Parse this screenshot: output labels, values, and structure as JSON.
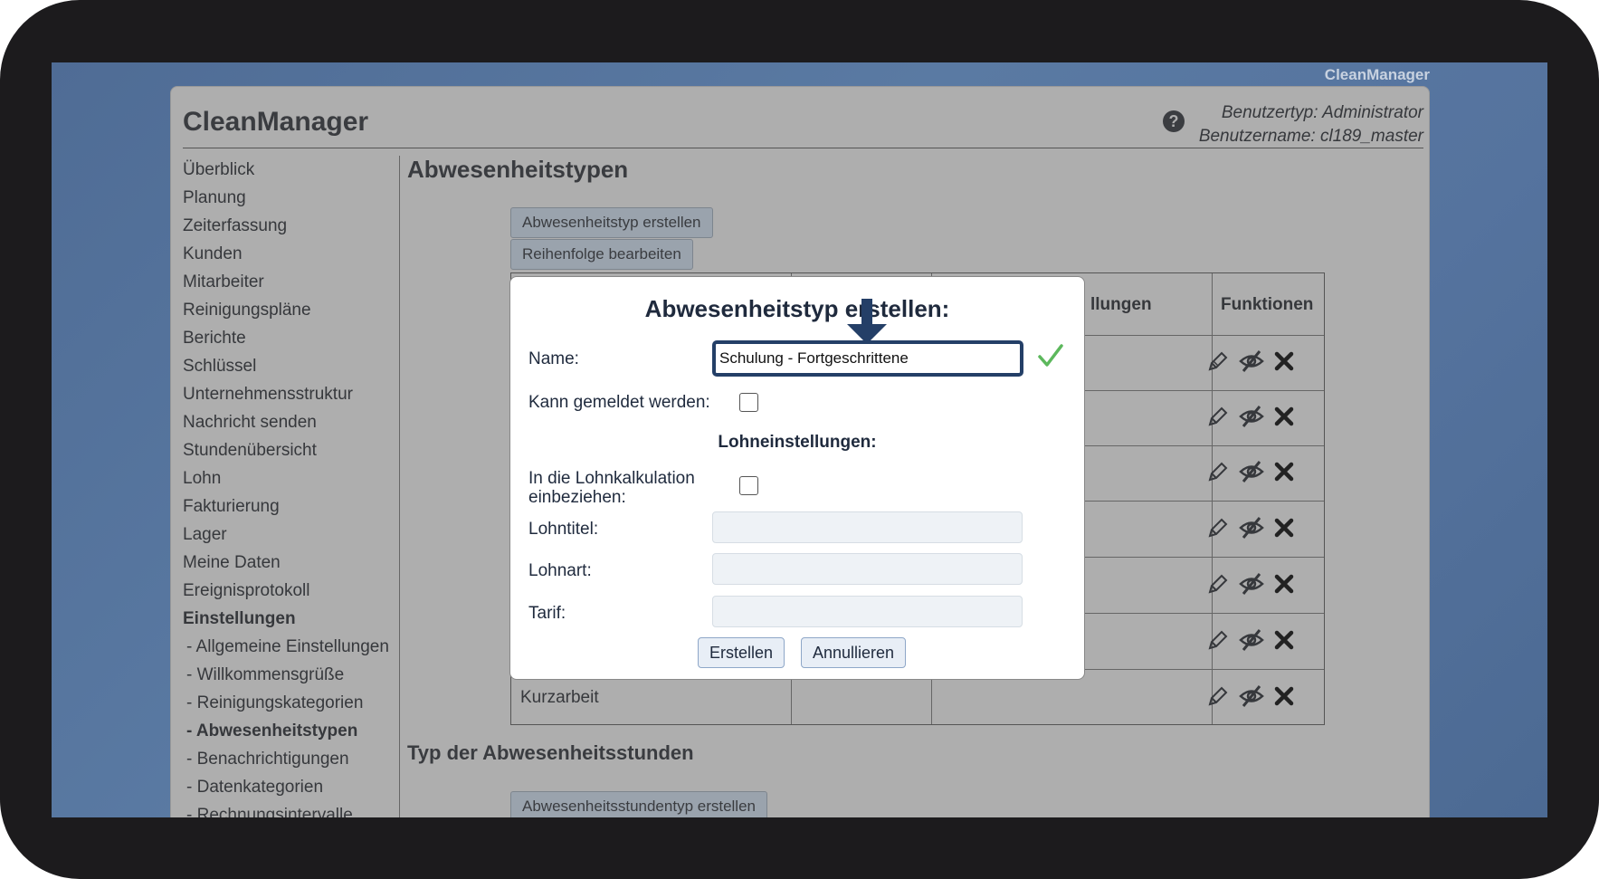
{
  "app": {
    "brand_small": "CleanManager",
    "title": "CleanManager",
    "help_icon": "?",
    "user_type": "Benutzertyp: Administrator",
    "user_name": "Benutzername: cl189_master"
  },
  "sidebar": {
    "items": [
      "Überblick",
      "Planung",
      "Zeiterfassung",
      "Kunden",
      "Mitarbeiter",
      "Reinigungspläne",
      "Berichte",
      "Schlüssel",
      "Unternehmensstruktur",
      "Nachricht senden",
      "Stundenübersicht",
      "Lohn",
      "Fakturierung",
      "Lager",
      "Meine Daten",
      "Ereignisprotokoll"
    ],
    "settings_label": "Einstellungen",
    "sub_items": [
      "- Allgemeine Einstellungen",
      "- Willkommensgrüße",
      "- Reinigungskategorien",
      "- Abwesenheitstypen",
      "- Benachrichtigungen",
      "- Datenkategorien",
      "- Rechnungsintervalle"
    ],
    "active_sub_index": 3
  },
  "main": {
    "heading": "Abwesenheitstypen",
    "create_button": "Abwesenheitstyp erstellen",
    "order_button": "Reihenfolge bearbeiten",
    "table": {
      "header_partial": "llungen",
      "header_functions": "Funktionen",
      "last_row_name": "Kurzarbeit"
    },
    "second_heading": "Typ der Abwesenheitsstunden",
    "second_create_button": "Abwesenheitsstundentyp erstellen"
  },
  "dialog": {
    "title": "Abwesenheitstyp erstellen:",
    "name_label": "Name:",
    "name_value": "Schulung - Fortgeschrittene",
    "can_report_label": "Kann gemeldet werden:",
    "wage_section": "Lohneinstellungen:",
    "include_label": "In die Lohnkalkulation einbeziehen:",
    "wage_title_label": "Lohntitel:",
    "wage_type_label": "Lohnart:",
    "tariff_label": "Tarif:",
    "create_button": "Erstellen",
    "cancel_button": "Annullieren"
  },
  "colors": {
    "accent": "#243f67",
    "valid_check": "#5cb85c"
  }
}
